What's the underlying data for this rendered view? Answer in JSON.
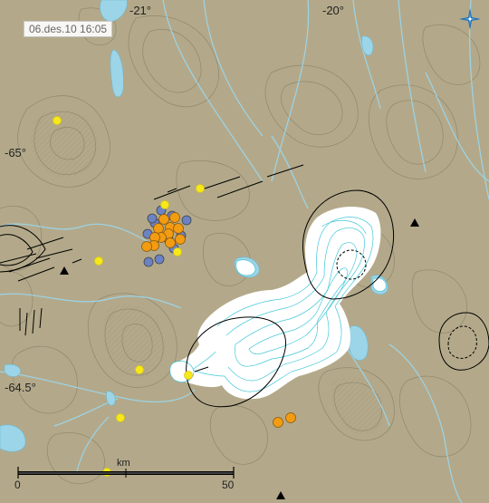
{
  "timestamp": "06.des.10 16:05",
  "graticule": {
    "lon_labels": [
      "-21°",
      "-20°"
    ],
    "lat_labels": [
      "-65°",
      "-64.5°"
    ]
  },
  "scalebar": {
    "unit": "km",
    "start": "0",
    "end": "50"
  },
  "colors": {
    "land": "#b3a98a",
    "glacier": "#ffffff",
    "contour_land": "#8c8469",
    "contour_ice": "#44c8d8",
    "water": "#9cd4e8",
    "quake_recent": "#f39c12",
    "quake_yellow": "#f7e81a",
    "quake_older": "#6b82c4"
  },
  "earthquakes": {
    "recent_orange": 14,
    "yellow": 9,
    "older_blue": 11
  },
  "logo": "compass-star-logo"
}
